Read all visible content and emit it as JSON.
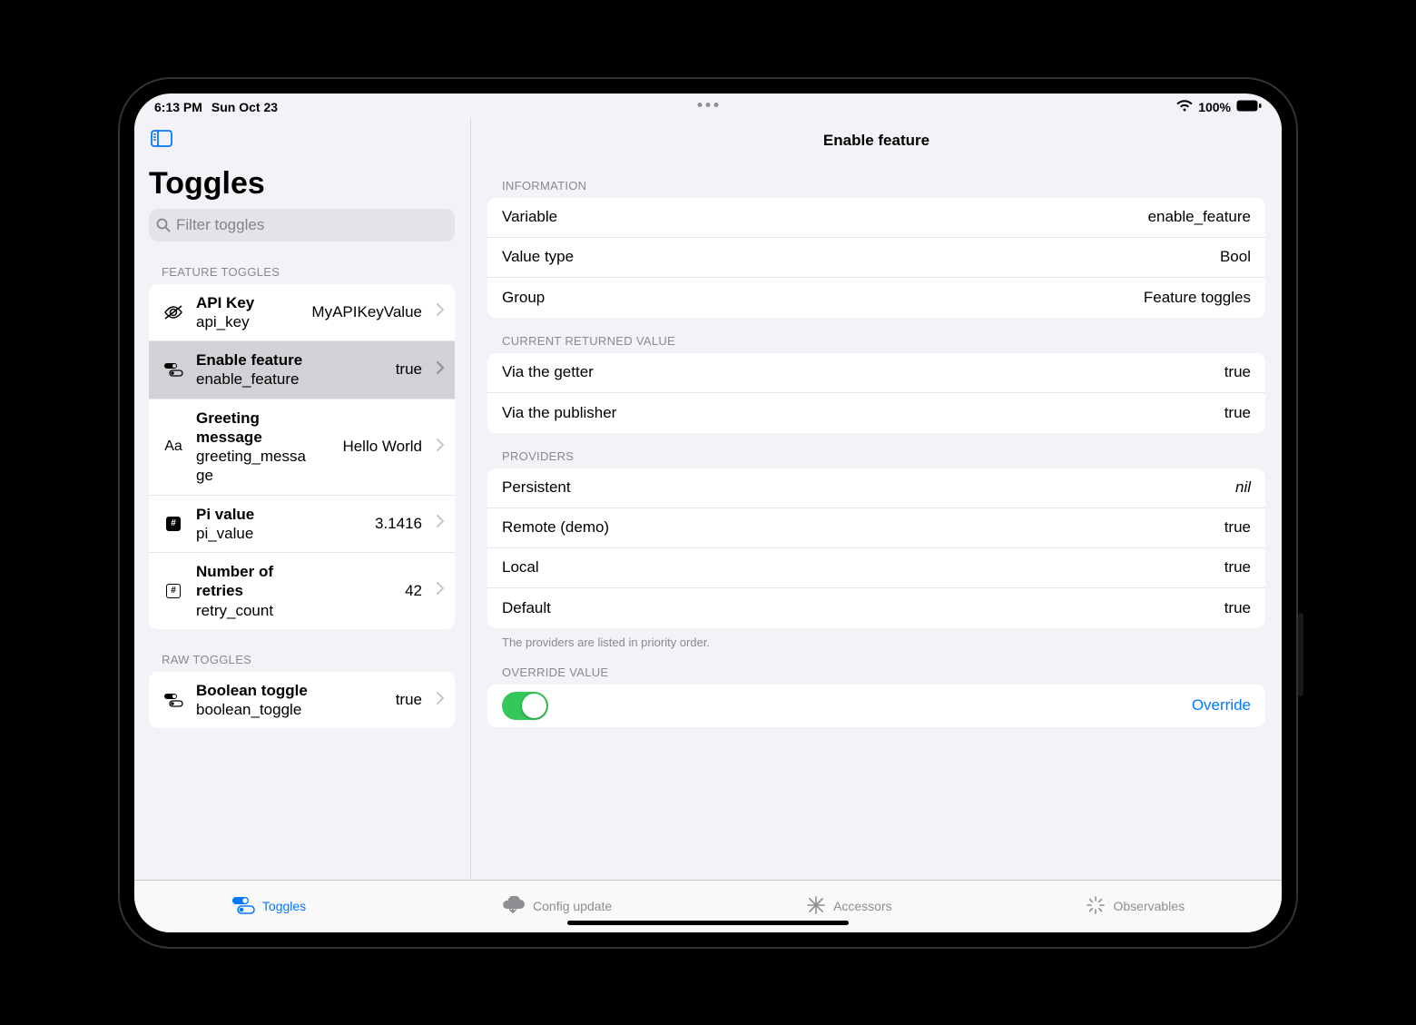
{
  "status": {
    "time": "6:13 PM",
    "date": "Sun Oct 23",
    "battery": "100%"
  },
  "sidebar": {
    "title": "Toggles",
    "search_placeholder": "Filter toggles",
    "sections": [
      {
        "header": "FEATURE TOGGLES",
        "items": [
          {
            "icon": "eye-slash",
            "title": "API Key",
            "sub": "api_key",
            "value": "MyAPIKeyValue"
          },
          {
            "icon": "toggles",
            "title": "Enable feature",
            "sub": "enable_feature",
            "value": "true",
            "selected": true
          },
          {
            "icon": "text",
            "title": "Greeting message",
            "sub": "greeting_message",
            "value": "Hello World"
          },
          {
            "icon": "hash-filled",
            "title": "Pi value",
            "sub": "pi_value",
            "value": "3.1416"
          },
          {
            "icon": "hash",
            "title": "Number of retries",
            "sub": "retry_count",
            "value": "42"
          }
        ]
      },
      {
        "header": "RAW TOGGLES",
        "items": [
          {
            "icon": "toggles",
            "title": "Boolean toggle",
            "sub": "boolean_toggle",
            "value": "true"
          }
        ]
      }
    ]
  },
  "detail": {
    "title": "Enable feature",
    "sections": {
      "information": {
        "header": "INFORMATION",
        "rows": [
          {
            "label": "Variable",
            "value": "enable_feature"
          },
          {
            "label": "Value type",
            "value": "Bool"
          },
          {
            "label": "Group",
            "value": "Feature toggles"
          }
        ]
      },
      "current": {
        "header": "CURRENT RETURNED VALUE",
        "rows": [
          {
            "label": "Via the getter",
            "value": "true"
          },
          {
            "label": "Via the publisher",
            "value": "true"
          }
        ]
      },
      "providers": {
        "header": "PROVIDERS",
        "rows": [
          {
            "label": "Persistent",
            "value": "nil",
            "italic": true
          },
          {
            "label": "Remote (demo)",
            "value": "true"
          },
          {
            "label": "Local",
            "value": "true"
          },
          {
            "label": "Default",
            "value": "true"
          }
        ],
        "footer": "The providers are listed in priority order."
      },
      "override": {
        "header": "OVERRIDE VALUE",
        "switch_on": true,
        "link": "Override"
      }
    }
  },
  "tabs": [
    {
      "label": "Toggles",
      "icon": "toggles",
      "active": true
    },
    {
      "label": "Config update",
      "icon": "cloud-download"
    },
    {
      "label": "Accessors",
      "icon": "snowflake"
    },
    {
      "label": "Observables",
      "icon": "burst"
    }
  ]
}
